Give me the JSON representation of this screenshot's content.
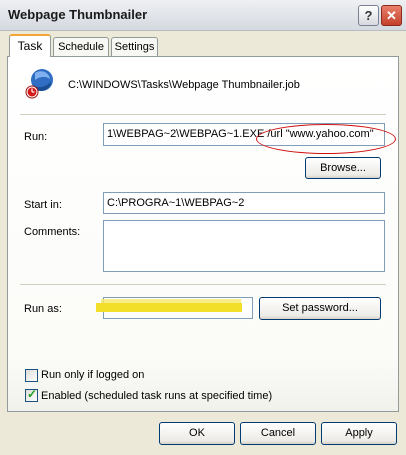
{
  "window": {
    "title": "Webpage Thumbnailer"
  },
  "titlebar": {
    "help_glyph": "?",
    "close_glyph": "✕"
  },
  "tabs": [
    {
      "label": "Task"
    },
    {
      "label": "Schedule"
    },
    {
      "label": "Settings"
    }
  ],
  "task": {
    "file_path": "C:\\WINDOWS\\Tasks\\Webpage Thumbnailer.job",
    "run_label": "Run:",
    "run_value": "1\\WEBPAG~2\\WEBPAG~1.EXE /url \"www.yahoo.com\"",
    "browse_label": "Browse...",
    "start_in_label": "Start in:",
    "start_in_value": "C:\\PROGRA~1\\WEBPAG~2",
    "comments_label": "Comments:",
    "comments_value": "",
    "run_as_label": "Run as:",
    "run_as_value": "",
    "set_password_label": "Set password...",
    "run_only_logged_on_label": "Run only if logged on",
    "run_only_logged_on_checked": false,
    "enabled_label": "Enabled (scheduled task runs at specified time)",
    "enabled_checked": true
  },
  "footer": {
    "ok_label": "OK",
    "cancel_label": "Cancel",
    "apply_label": "Apply"
  },
  "colors": {
    "annotation": "#d01010",
    "redaction": "#f2df2a",
    "tab_highlight": "#f3a536"
  }
}
